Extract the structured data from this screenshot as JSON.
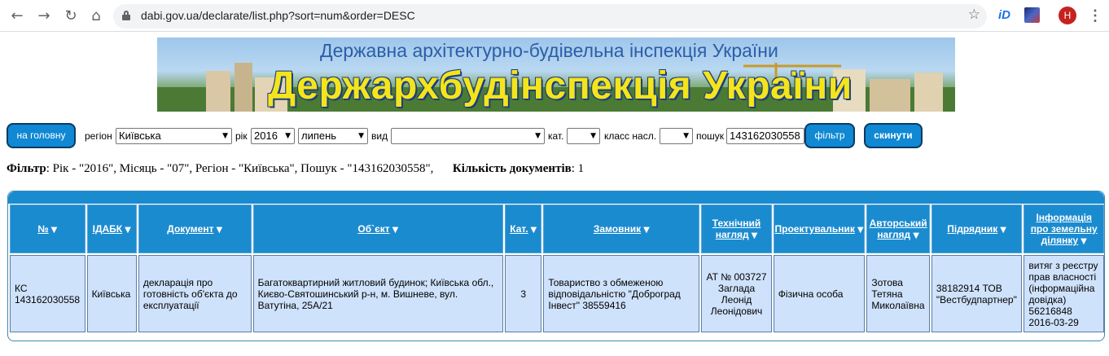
{
  "browser": {
    "url": "dabi.gov.ua/declarate/list.php?sort=num&order=DESC",
    "avatar_letter": "H",
    "ext_label": "iD"
  },
  "banner": {
    "subtitle": "Державна архітектурно-будівельна інспекція України",
    "title": "Держархбудінспекція України"
  },
  "filters": {
    "home_button": "на головну",
    "region_label": "регіон",
    "region_value": "Київська",
    "year_label": "рік",
    "year_value": "2016",
    "month_value": "липень",
    "type_label": "вид",
    "type_value": "",
    "cat_label": "кат.",
    "cat_value": "",
    "class_label": "класс насл.",
    "class_value": "",
    "search_label": "пошук",
    "search_value": "143162030558",
    "filter_button": "фільтр",
    "reset_button": "скинути"
  },
  "summary": {
    "filter_label": "Фільтр",
    "filter_text": ": Рік - \"2016\", Місяць - \"07\", Регіон - \"Київська\", Пошук - \"143162030558\",",
    "count_label": "Кількість документів",
    "count_text": ": 1"
  },
  "table": {
    "columns": [
      {
        "label": "№",
        "line2": ""
      },
      {
        "label": "ІДАБК",
        "line2": ""
      },
      {
        "label": "Документ",
        "line2": ""
      },
      {
        "label": "Об`єкт",
        "line2": ""
      },
      {
        "label": "Кат.",
        "line2": ""
      },
      {
        "label": "Замовник",
        "line2": ""
      },
      {
        "label": "Технічний",
        "line2": "нагляд"
      },
      {
        "label": "Проектувальник",
        "line2": ""
      },
      {
        "label": "Авторський",
        "line2": "нагляд"
      },
      {
        "label": "Підрядник",
        "line2": ""
      },
      {
        "label": "Інформація",
        "line2": "про земельну",
        "line3": "ділянку"
      }
    ],
    "rows": [
      {
        "num": "КС 143162030558",
        "idabk": "Київська",
        "document": "декларація про готовність об'єкта до експлуатації",
        "object": "Багатоквартирний житловий будинок; Київська обл., Києво-Святошинський р-н, м. Вишневе, вул. Ватутіна, 25А/21",
        "category": "3",
        "customer": "Товариство з обмеженою відповідальністю \"Доброград Інвест\" 38559416",
        "tech_supervision": "АТ № 003727 Заглада Леонід Леонідович",
        "designer": "Фізична особа",
        "author_supervision": "Зотова Тетяна Миколаївна",
        "contractor": "38182914 ТОВ \"Вестбудпартнер\"",
        "land_info": "витяг з реєстру прав власності (інформаційна довідка) 56216848 2016-03-29"
      }
    ]
  }
}
